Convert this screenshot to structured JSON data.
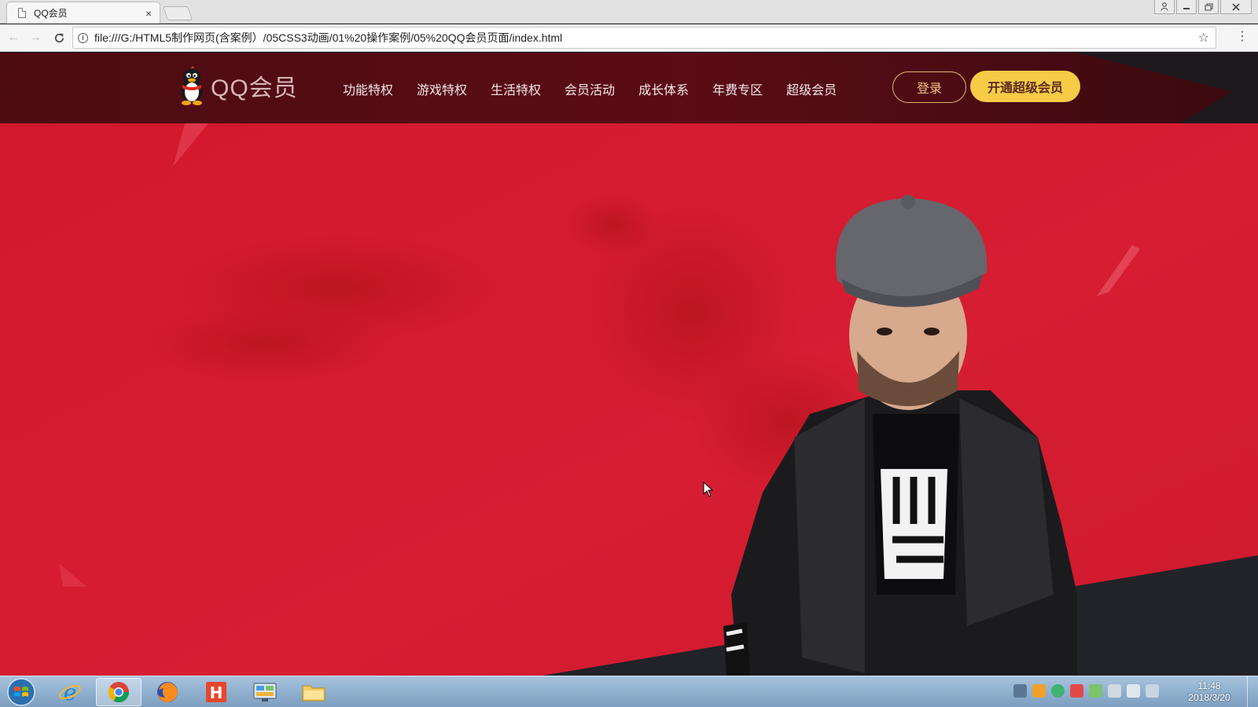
{
  "browser": {
    "tab_title": "QQ会员",
    "tab_close": "×",
    "url": "file:///G:/HTML5制作网页(含案例）/05CSS3动画/01%20操作案例/05%20QQ会员页面/index.html",
    "back_icon": "←",
    "forward_icon": "→",
    "reload_icon": "C",
    "info_icon": "i",
    "star_icon": "☆",
    "menu_icon": "⋮",
    "window_buttons": [
      "person-icon",
      "minimize-icon",
      "restore-icon",
      "close-icon"
    ]
  },
  "site": {
    "logo_text": "QQ会员",
    "nav": [
      "功能特权",
      "游戏特权",
      "生活特权",
      "会员活动",
      "成长体系",
      "年费专区",
      "超级会员"
    ],
    "login_label": "登录",
    "open_vip_label": "开通超级会员",
    "colors": {
      "header": "#4d0b12",
      "hero": "#d61d32",
      "vip_button": "#f7cb45",
      "login_border": "#e0b86a"
    }
  },
  "taskbar": {
    "apps": [
      "internet-explorer",
      "chrome",
      "firefox",
      "hbuilder",
      "control-panel",
      "file-explorer"
    ],
    "active_app": "chrome",
    "clock_time": "11:48",
    "clock_date": "2018/3/20"
  }
}
